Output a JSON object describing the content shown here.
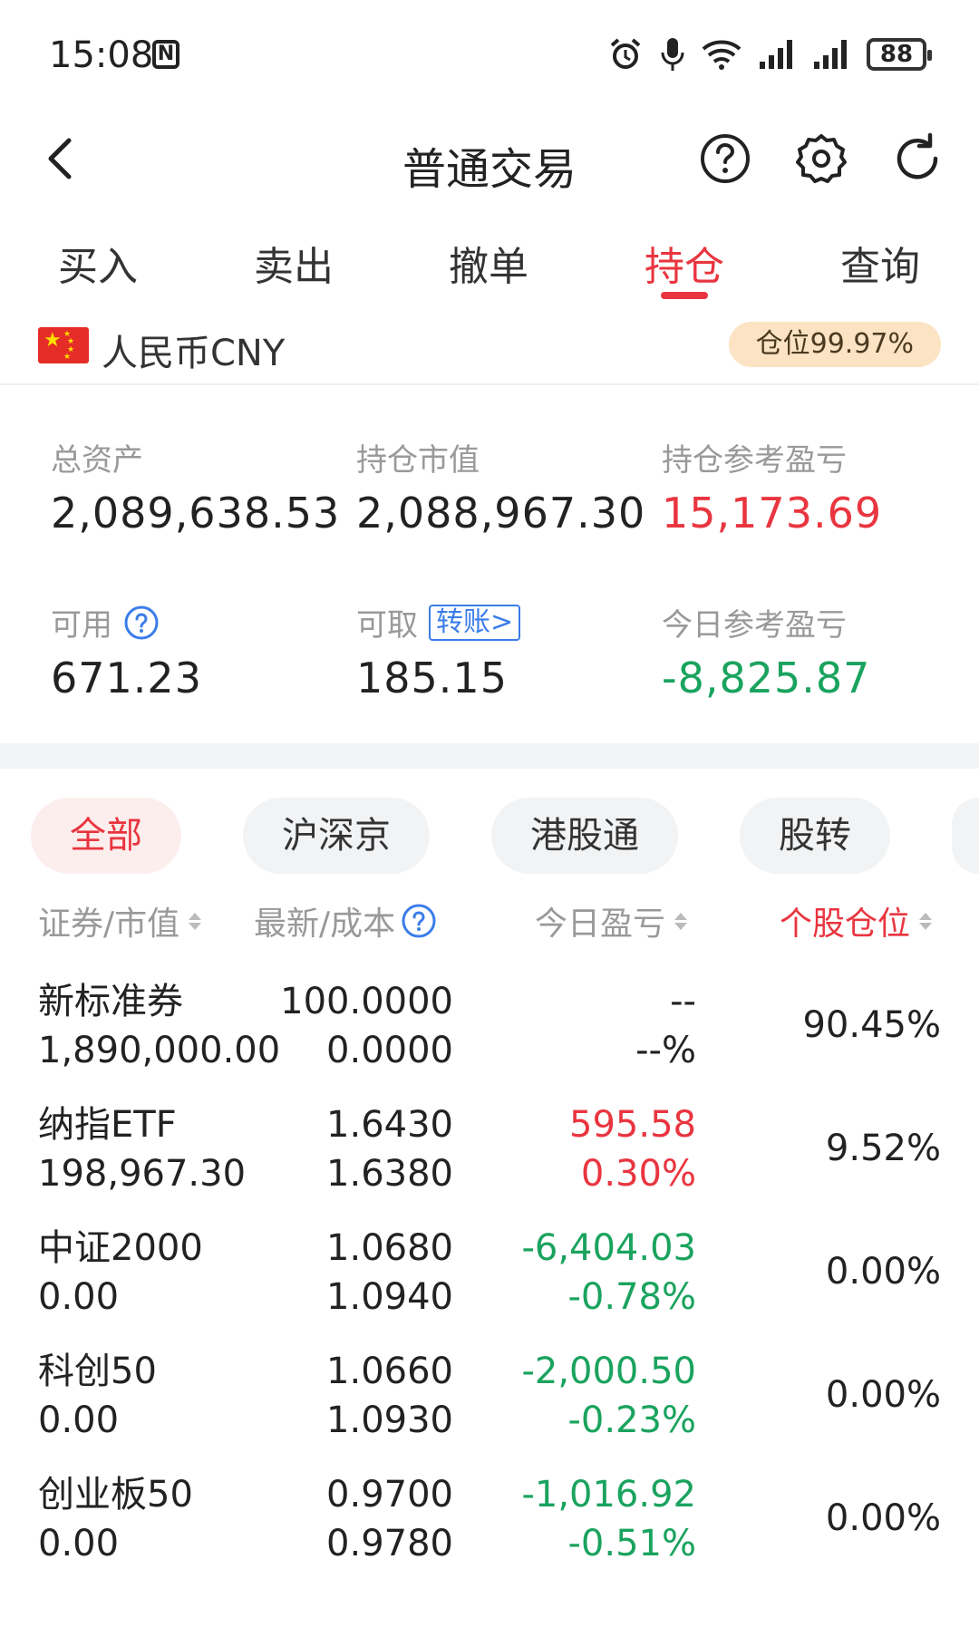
{
  "status_bar": {
    "time": "15:08",
    "nfc": "N",
    "battery": "88"
  },
  "header": {
    "title": "普通交易"
  },
  "tabs": [
    {
      "label": "买入"
    },
    {
      "label": "卖出"
    },
    {
      "label": "撤单"
    },
    {
      "label": "持仓"
    },
    {
      "label": "查询"
    }
  ],
  "currency": {
    "label": "人民币CNY",
    "position_badge": "仓位99.97%"
  },
  "summary": {
    "total_assets_label": "总资产",
    "total_assets": "2,089,638.53",
    "market_value_label": "持仓市值",
    "market_value": "2,088,967.30",
    "position_pnl_label": "持仓参考盈亏",
    "position_pnl": "15,173.69",
    "available_label": "可用",
    "available": "671.23",
    "withdrawable_label": "可取",
    "transfer_label": "转账>",
    "withdrawable": "185.15",
    "today_pnl_label": "今日参考盈亏",
    "today_pnl": "-8,825.87"
  },
  "filters": [
    {
      "label": "全部"
    },
    {
      "label": "沪深京"
    },
    {
      "label": "港股通"
    },
    {
      "label": "股转"
    }
  ],
  "columns": {
    "security": "证券/市值",
    "price": "最新/成本",
    "today_pnl": "今日盈亏",
    "weight": "个股仓位"
  },
  "holdings": [
    {
      "name": "新标准券",
      "value": "1,890,000.00",
      "latest": "100.0000",
      "cost": "0.0000",
      "pnl": "--",
      "pnl_pct": "--%",
      "weight": "90.45%",
      "color": "#222222"
    },
    {
      "name": "纳指ETF",
      "value": "198,967.30",
      "latest": "1.6430",
      "cost": "1.6380",
      "pnl": "595.58",
      "pnl_pct": "0.30%",
      "weight": "9.52%",
      "color": "#e9353f"
    },
    {
      "name": "中证2000",
      "value": "0.00",
      "latest": "1.0680",
      "cost": "1.0940",
      "pnl": "-6,404.03",
      "pnl_pct": "-0.78%",
      "weight": "0.00%",
      "color": "#1aa35e"
    },
    {
      "name": "科创50",
      "value": "0.00",
      "latest": "1.0660",
      "cost": "1.0930",
      "pnl": "-2,000.50",
      "pnl_pct": "-0.23%",
      "weight": "0.00%",
      "color": "#1aa35e"
    },
    {
      "name": "创业板50",
      "value": "0.00",
      "latest": "0.9700",
      "cost": "0.9780",
      "pnl": "-1,016.92",
      "pnl_pct": "-0.51%",
      "weight": "0.00%",
      "color": "#1aa35e"
    }
  ]
}
